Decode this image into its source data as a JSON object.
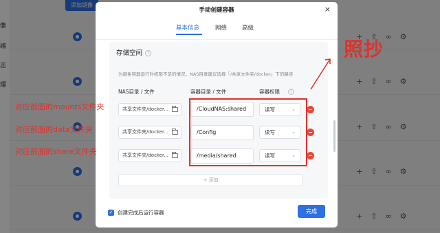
{
  "background": {
    "add_button": "添加镜像",
    "sidebar_labels": [
      "像",
      "络",
      "志",
      "理"
    ]
  },
  "modal": {
    "title": "手动创建容器",
    "close": "×",
    "tabs": [
      {
        "label": "基本信息",
        "active": true
      },
      {
        "label": "网络",
        "active": false
      },
      {
        "label": "高级",
        "active": false
      }
    ],
    "section_title": "存储空间",
    "hint": "为避免容器运行时权限不足的情况，NAS目录建议选择「/共享文件夹/docker」下的路径",
    "columns": {
      "nas": "NAS目录 / 文件",
      "container": "容器目录 / 文件",
      "permission": "容器权限"
    },
    "rows": [
      {
        "nas": "共享文件夹/docker...",
        "container": "/CloudNAS:shared",
        "permission": "读写"
      },
      {
        "nas": "共享文件夹/docker...",
        "container": "/Config",
        "permission": "读写"
      },
      {
        "nas": "共享文件夹/docker...",
        "container": "/media/shared",
        "permission": "读写"
      }
    ],
    "add_label": "+ 添加",
    "auto_run_label": "创建完成后运行容器",
    "auto_run_checked": true,
    "done_label": "完成"
  },
  "annotations": {
    "row_notes": [
      "对应前面的mounts文件夹",
      "对应前面的data文件夹",
      "对应前面的share文件夹"
    ],
    "big_note": "照抄",
    "color": "#e0312b"
  },
  "colors": {
    "primary": "#2f6fe0",
    "danger": "#e74a3b"
  }
}
